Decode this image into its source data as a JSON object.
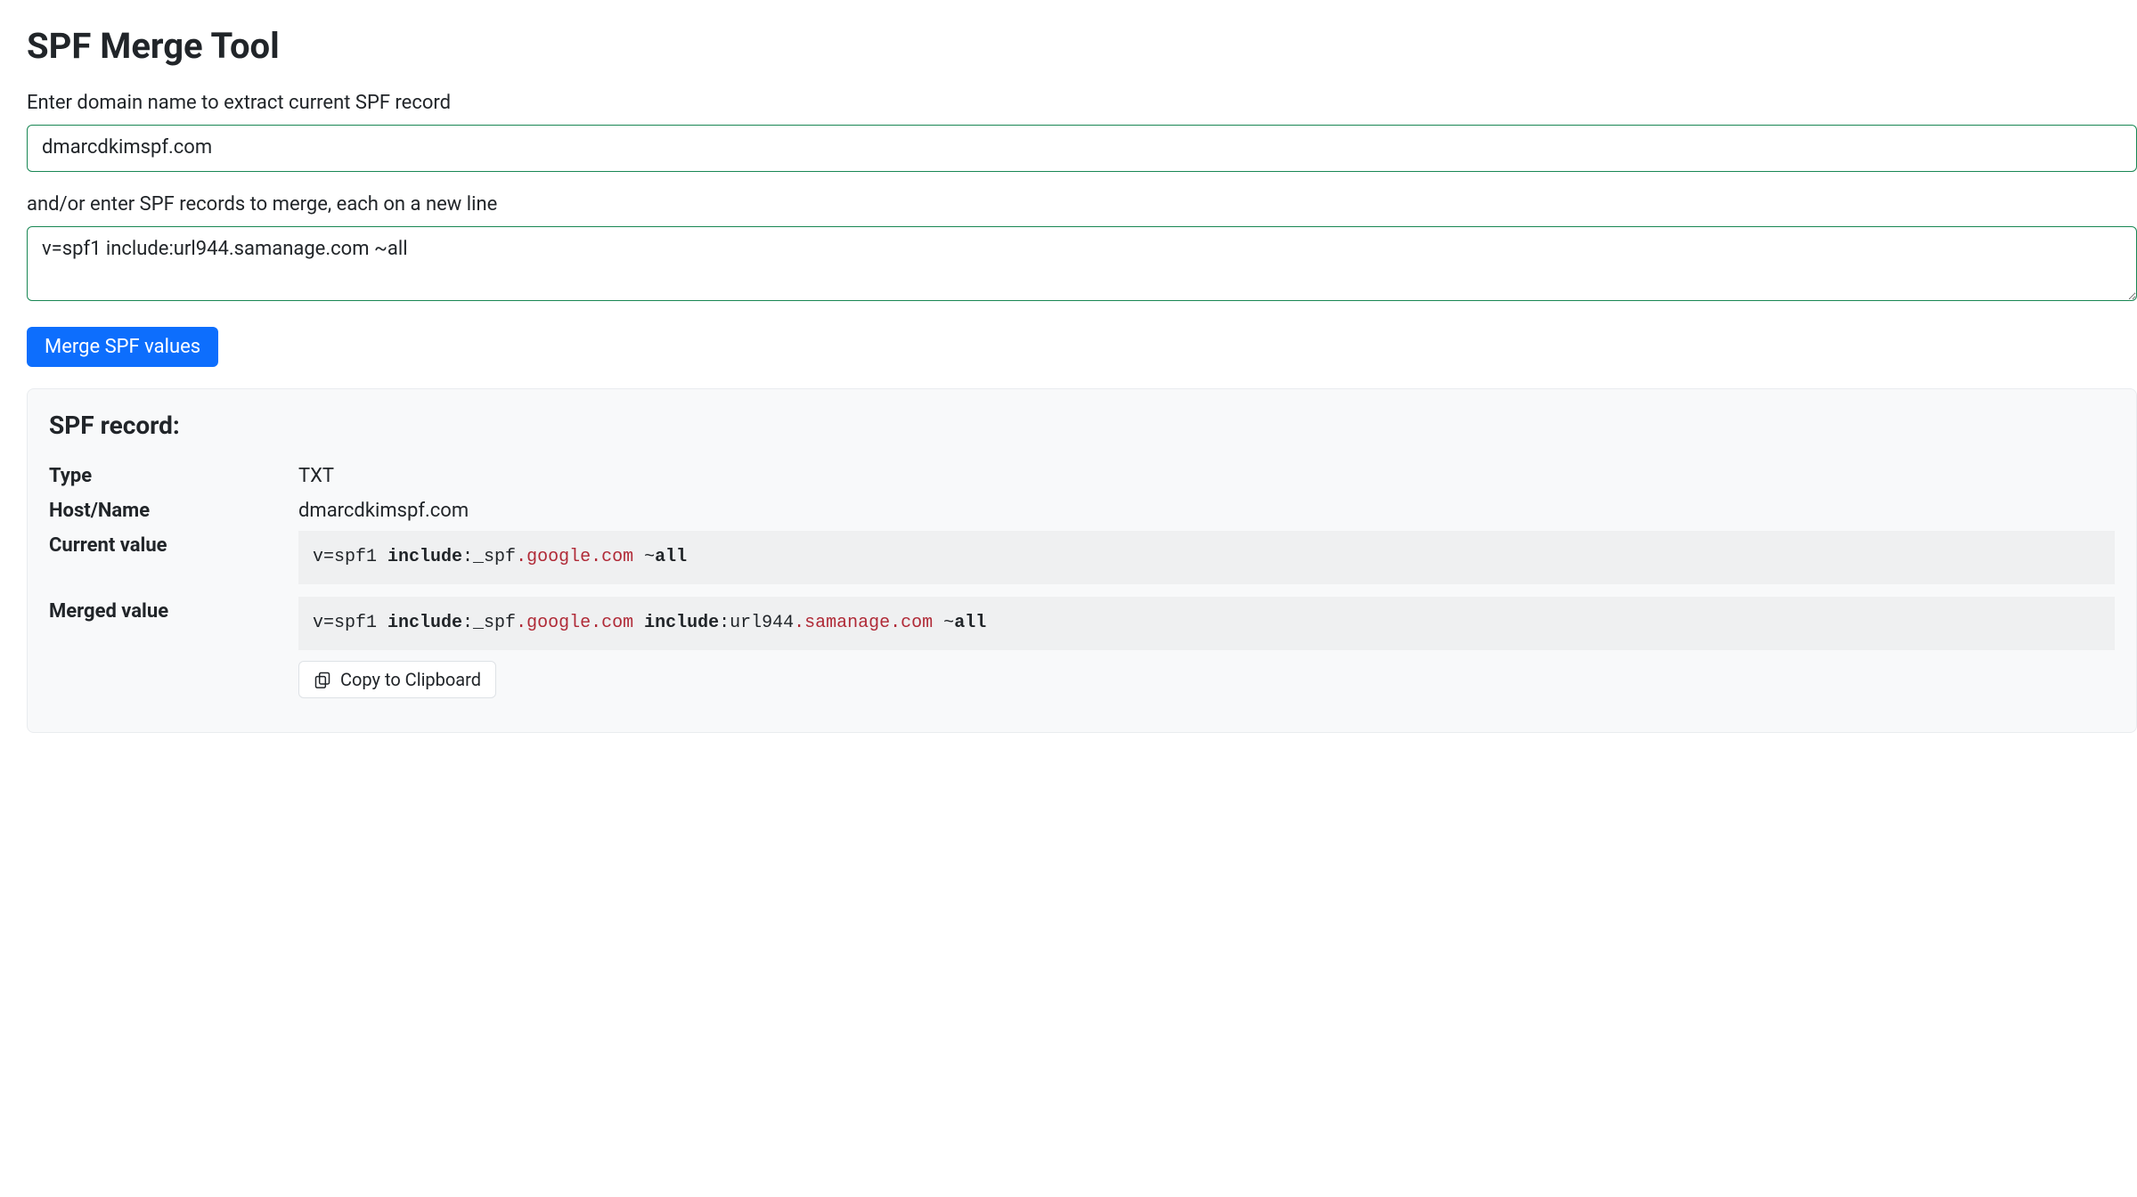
{
  "title": "SPF Merge Tool",
  "form": {
    "domain_label": "Enter domain name to extract current SPF record",
    "domain_value": "dmarcdkimspf.com",
    "merge_label": "and/or enter SPF records to merge, each on a new line",
    "merge_value": "v=spf1 include:url944.samanage.com ~all",
    "submit_label": "Merge SPF values"
  },
  "result": {
    "heading": "SPF record:",
    "rows": {
      "type_label": "Type",
      "type_value": "TXT",
      "host_label": "Host/Name",
      "host_value": "dmarcdkimspf.com",
      "current_label": "Current value",
      "merged_label": "Merged value"
    },
    "current_value_tokens": [
      {
        "t": "v",
        "c": "plain"
      },
      {
        "t": "=spf1 ",
        "c": "plain"
      },
      {
        "t": "include",
        "c": "bold"
      },
      {
        "t": ":_spf",
        "c": "plain"
      },
      {
        "t": ".google.com",
        "c": "red"
      },
      {
        "t": " ~",
        "c": "plain"
      },
      {
        "t": "all",
        "c": "bold"
      }
    ],
    "merged_value_tokens": [
      {
        "t": "v",
        "c": "plain"
      },
      {
        "t": "=spf1 ",
        "c": "plain"
      },
      {
        "t": "include",
        "c": "bold"
      },
      {
        "t": ":_spf",
        "c": "plain"
      },
      {
        "t": ".google.com",
        "c": "red"
      },
      {
        "t": " ",
        "c": "plain"
      },
      {
        "t": "include",
        "c": "bold"
      },
      {
        "t": ":url944",
        "c": "plain"
      },
      {
        "t": ".samanage.com",
        "c": "red"
      },
      {
        "t": " ~",
        "c": "plain"
      },
      {
        "t": "all",
        "c": "bold"
      }
    ],
    "copy_label": "Copy to Clipboard"
  }
}
